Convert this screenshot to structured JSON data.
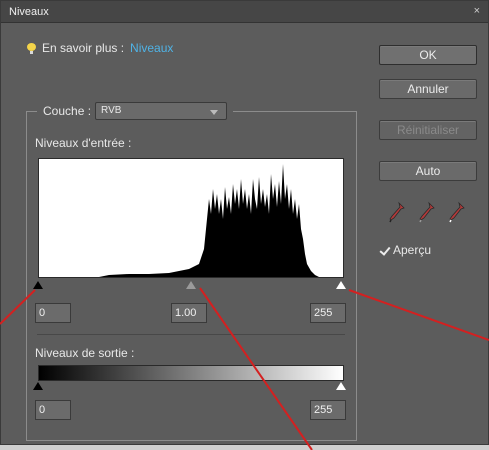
{
  "window": {
    "title": "Niveaux",
    "close_glyph": "×"
  },
  "learn_more": {
    "label": "En savoir plus :",
    "link": "Niveaux"
  },
  "buttons": {
    "ok": "OK",
    "cancel": "Annuler",
    "reset": "Réinitialiser",
    "auto": "Auto"
  },
  "channel": {
    "label": "Couche :",
    "value": "RVB"
  },
  "input_levels": {
    "label": "Niveaux d'entrée :",
    "black": "0",
    "gamma": "1.00",
    "white": "255"
  },
  "output_levels": {
    "label": "Niveaux de sortie :",
    "black": "0",
    "white": "255"
  },
  "preview": {
    "label": "Aperçu",
    "checked": true
  },
  "eyedroppers": [
    "black-point-eyedropper-icon",
    "gray-point-eyedropper-icon",
    "white-point-eyedropper-icon"
  ],
  "colors": {
    "dialog_bg": "#5c5c5c",
    "link": "#4fb3e6",
    "annotation_line": "#d42020"
  }
}
